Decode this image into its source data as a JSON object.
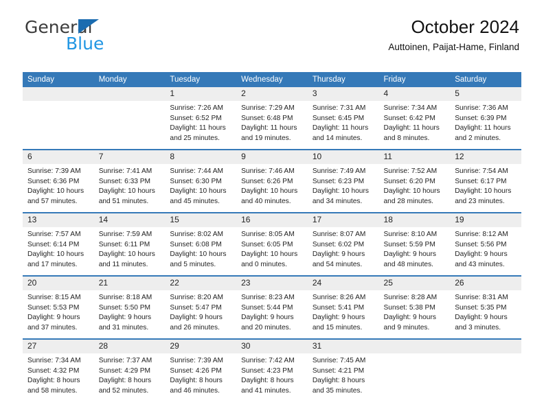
{
  "brand": {
    "name_part1": "General",
    "name_part2": "Blue",
    "triangle_icon": "triangle-icon",
    "accent_dark_blue": "#1b6cb0",
    "accent_light_blue": "#2196e3"
  },
  "header": {
    "title": "October 2024",
    "subtitle": "Auttoinen, Paijat-Hame, Finland"
  },
  "theme": {
    "header_row_bg": "#3579b8",
    "daynum_bg": "#eeeeee",
    "cell_bg": "#ffffff",
    "text": "#222222"
  },
  "weekdays": [
    "Sunday",
    "Monday",
    "Tuesday",
    "Wednesday",
    "Thursday",
    "Friday",
    "Saturday"
  ],
  "weeks": [
    [
      {
        "day": "",
        "sunrise": "",
        "sunset": "",
        "daylight1": "",
        "daylight2": ""
      },
      {
        "day": "",
        "sunrise": "",
        "sunset": "",
        "daylight1": "",
        "daylight2": ""
      },
      {
        "day": "1",
        "sunrise": "Sunrise: 7:26 AM",
        "sunset": "Sunset: 6:52 PM",
        "daylight1": "Daylight: 11 hours",
        "daylight2": "and 25 minutes."
      },
      {
        "day": "2",
        "sunrise": "Sunrise: 7:29 AM",
        "sunset": "Sunset: 6:48 PM",
        "daylight1": "Daylight: 11 hours",
        "daylight2": "and 19 minutes."
      },
      {
        "day": "3",
        "sunrise": "Sunrise: 7:31 AM",
        "sunset": "Sunset: 6:45 PM",
        "daylight1": "Daylight: 11 hours",
        "daylight2": "and 14 minutes."
      },
      {
        "day": "4",
        "sunrise": "Sunrise: 7:34 AM",
        "sunset": "Sunset: 6:42 PM",
        "daylight1": "Daylight: 11 hours",
        "daylight2": "and 8 minutes."
      },
      {
        "day": "5",
        "sunrise": "Sunrise: 7:36 AM",
        "sunset": "Sunset: 6:39 PM",
        "daylight1": "Daylight: 11 hours",
        "daylight2": "and 2 minutes."
      }
    ],
    [
      {
        "day": "6",
        "sunrise": "Sunrise: 7:39 AM",
        "sunset": "Sunset: 6:36 PM",
        "daylight1": "Daylight: 10 hours",
        "daylight2": "and 57 minutes."
      },
      {
        "day": "7",
        "sunrise": "Sunrise: 7:41 AM",
        "sunset": "Sunset: 6:33 PM",
        "daylight1": "Daylight: 10 hours",
        "daylight2": "and 51 minutes."
      },
      {
        "day": "8",
        "sunrise": "Sunrise: 7:44 AM",
        "sunset": "Sunset: 6:30 PM",
        "daylight1": "Daylight: 10 hours",
        "daylight2": "and 45 minutes."
      },
      {
        "day": "9",
        "sunrise": "Sunrise: 7:46 AM",
        "sunset": "Sunset: 6:26 PM",
        "daylight1": "Daylight: 10 hours",
        "daylight2": "and 40 minutes."
      },
      {
        "day": "10",
        "sunrise": "Sunrise: 7:49 AM",
        "sunset": "Sunset: 6:23 PM",
        "daylight1": "Daylight: 10 hours",
        "daylight2": "and 34 minutes."
      },
      {
        "day": "11",
        "sunrise": "Sunrise: 7:52 AM",
        "sunset": "Sunset: 6:20 PM",
        "daylight1": "Daylight: 10 hours",
        "daylight2": "and 28 minutes."
      },
      {
        "day": "12",
        "sunrise": "Sunrise: 7:54 AM",
        "sunset": "Sunset: 6:17 PM",
        "daylight1": "Daylight: 10 hours",
        "daylight2": "and 23 minutes."
      }
    ],
    [
      {
        "day": "13",
        "sunrise": "Sunrise: 7:57 AM",
        "sunset": "Sunset: 6:14 PM",
        "daylight1": "Daylight: 10 hours",
        "daylight2": "and 17 minutes."
      },
      {
        "day": "14",
        "sunrise": "Sunrise: 7:59 AM",
        "sunset": "Sunset: 6:11 PM",
        "daylight1": "Daylight: 10 hours",
        "daylight2": "and 11 minutes."
      },
      {
        "day": "15",
        "sunrise": "Sunrise: 8:02 AM",
        "sunset": "Sunset: 6:08 PM",
        "daylight1": "Daylight: 10 hours",
        "daylight2": "and 5 minutes."
      },
      {
        "day": "16",
        "sunrise": "Sunrise: 8:05 AM",
        "sunset": "Sunset: 6:05 PM",
        "daylight1": "Daylight: 10 hours",
        "daylight2": "and 0 minutes."
      },
      {
        "day": "17",
        "sunrise": "Sunrise: 8:07 AM",
        "sunset": "Sunset: 6:02 PM",
        "daylight1": "Daylight: 9 hours",
        "daylight2": "and 54 minutes."
      },
      {
        "day": "18",
        "sunrise": "Sunrise: 8:10 AM",
        "sunset": "Sunset: 5:59 PM",
        "daylight1": "Daylight: 9 hours",
        "daylight2": "and 48 minutes."
      },
      {
        "day": "19",
        "sunrise": "Sunrise: 8:12 AM",
        "sunset": "Sunset: 5:56 PM",
        "daylight1": "Daylight: 9 hours",
        "daylight2": "and 43 minutes."
      }
    ],
    [
      {
        "day": "20",
        "sunrise": "Sunrise: 8:15 AM",
        "sunset": "Sunset: 5:53 PM",
        "daylight1": "Daylight: 9 hours",
        "daylight2": "and 37 minutes."
      },
      {
        "day": "21",
        "sunrise": "Sunrise: 8:18 AM",
        "sunset": "Sunset: 5:50 PM",
        "daylight1": "Daylight: 9 hours",
        "daylight2": "and 31 minutes."
      },
      {
        "day": "22",
        "sunrise": "Sunrise: 8:20 AM",
        "sunset": "Sunset: 5:47 PM",
        "daylight1": "Daylight: 9 hours",
        "daylight2": "and 26 minutes."
      },
      {
        "day": "23",
        "sunrise": "Sunrise: 8:23 AM",
        "sunset": "Sunset: 5:44 PM",
        "daylight1": "Daylight: 9 hours",
        "daylight2": "and 20 minutes."
      },
      {
        "day": "24",
        "sunrise": "Sunrise: 8:26 AM",
        "sunset": "Sunset: 5:41 PM",
        "daylight1": "Daylight: 9 hours",
        "daylight2": "and 15 minutes."
      },
      {
        "day": "25",
        "sunrise": "Sunrise: 8:28 AM",
        "sunset": "Sunset: 5:38 PM",
        "daylight1": "Daylight: 9 hours",
        "daylight2": "and 9 minutes."
      },
      {
        "day": "26",
        "sunrise": "Sunrise: 8:31 AM",
        "sunset": "Sunset: 5:35 PM",
        "daylight1": "Daylight: 9 hours",
        "daylight2": "and 3 minutes."
      }
    ],
    [
      {
        "day": "27",
        "sunrise": "Sunrise: 7:34 AM",
        "sunset": "Sunset: 4:32 PM",
        "daylight1": "Daylight: 8 hours",
        "daylight2": "and 58 minutes."
      },
      {
        "day": "28",
        "sunrise": "Sunrise: 7:37 AM",
        "sunset": "Sunset: 4:29 PM",
        "daylight1": "Daylight: 8 hours",
        "daylight2": "and 52 minutes."
      },
      {
        "day": "29",
        "sunrise": "Sunrise: 7:39 AM",
        "sunset": "Sunset: 4:26 PM",
        "daylight1": "Daylight: 8 hours",
        "daylight2": "and 46 minutes."
      },
      {
        "day": "30",
        "sunrise": "Sunrise: 7:42 AM",
        "sunset": "Sunset: 4:23 PM",
        "daylight1": "Daylight: 8 hours",
        "daylight2": "and 41 minutes."
      },
      {
        "day": "31",
        "sunrise": "Sunrise: 7:45 AM",
        "sunset": "Sunset: 4:21 PM",
        "daylight1": "Daylight: 8 hours",
        "daylight2": "and 35 minutes."
      },
      {
        "day": "",
        "sunrise": "",
        "sunset": "",
        "daylight1": "",
        "daylight2": ""
      },
      {
        "day": "",
        "sunrise": "",
        "sunset": "",
        "daylight1": "",
        "daylight2": ""
      }
    ]
  ]
}
